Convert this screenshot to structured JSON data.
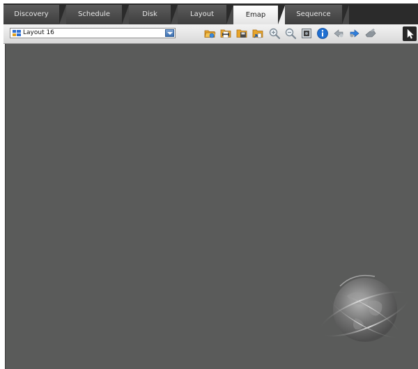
{
  "tabs": [
    {
      "label": "Discovery",
      "active": false
    },
    {
      "label": "Schedule",
      "active": false
    },
    {
      "label": "Disk",
      "active": false
    },
    {
      "label": "Layout",
      "active": false
    },
    {
      "label": "Emap",
      "active": true
    },
    {
      "label": "Sequence",
      "active": false
    }
  ],
  "toolbar": {
    "layout_select": {
      "value": "Layout 16",
      "icon": "layout-grid-icon"
    },
    "tools": [
      "open-map-icon",
      "print-map-icon",
      "save-map-icon",
      "import-map-icon",
      "zoom-in-icon",
      "zoom-out-icon",
      "fit-to-window-icon",
      "info-icon",
      "previous-map-icon",
      "next-map-icon",
      "home-map-icon",
      "pointer-icon"
    ]
  },
  "colors": {
    "tabbar_bg": "#2b2b2b",
    "canvas_bg": "#5a5b5a",
    "accent_blue": "#3b6fb0"
  }
}
